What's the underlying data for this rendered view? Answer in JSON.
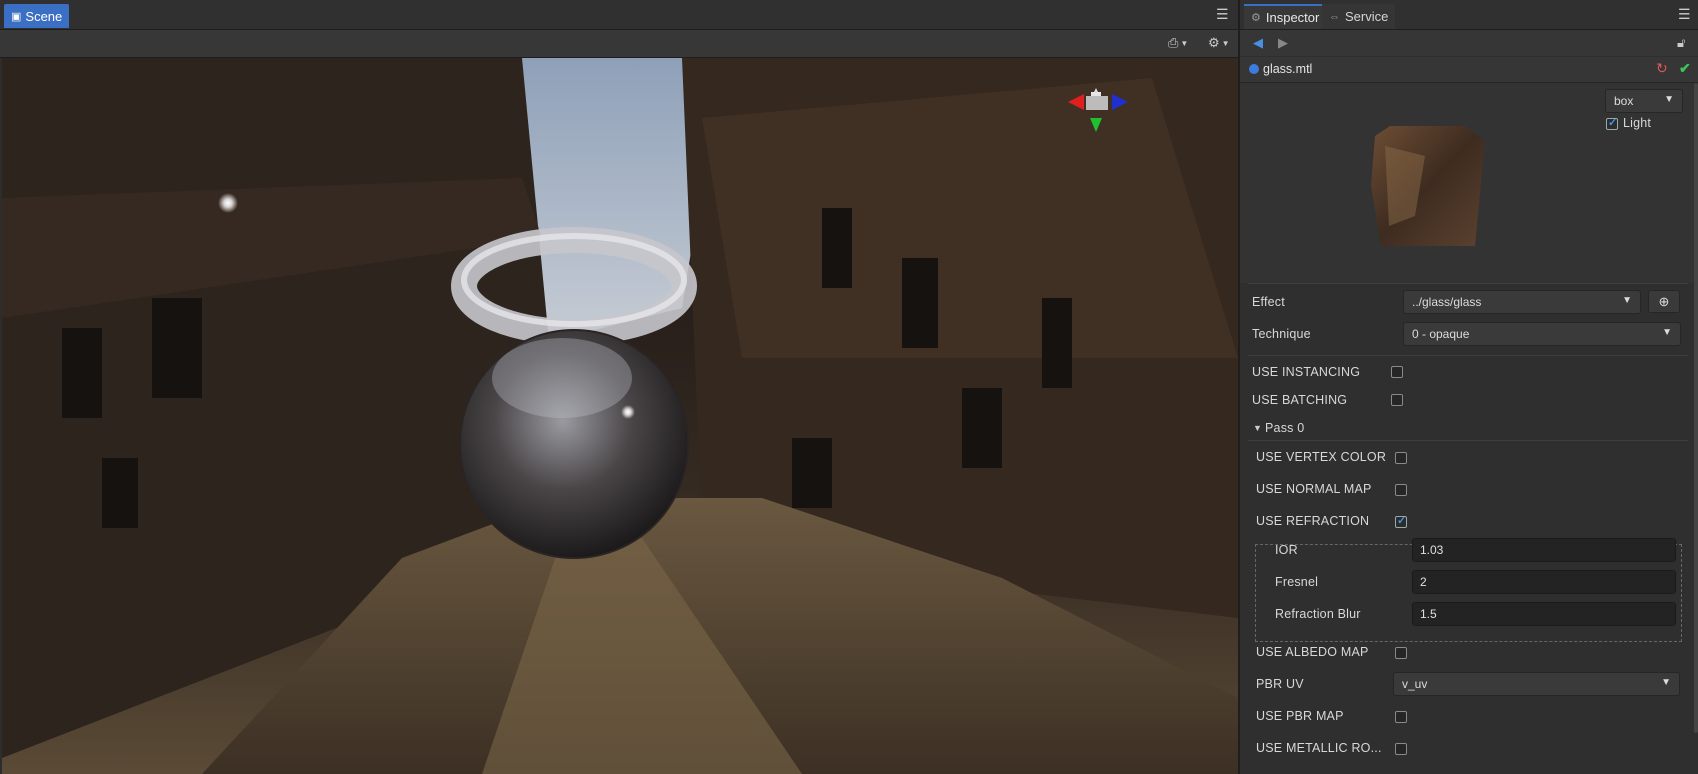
{
  "scene": {
    "tab_label": "Scene",
    "menu_icon": "hamburger-menu-icon",
    "toolbar": {
      "camera_icon": "camera-icon",
      "gear_icon": "gear-icon"
    }
  },
  "inspector": {
    "tabs": [
      {
        "label": "Inspector",
        "icon": "gear-icon"
      },
      {
        "label": "Service",
        "icon": "link-icon"
      }
    ],
    "file_name": "glass.mtl",
    "preview": {
      "mesh": "box",
      "light_label": "Light",
      "light_checked": true
    },
    "effect": {
      "label": "Effect",
      "value": "../glass/glass"
    },
    "technique": {
      "label": "Technique",
      "value": "0 - opaque"
    },
    "use_instancing": {
      "label": "USE  INSTANCING",
      "checked": false
    },
    "use_batching": {
      "label": "USE  BATCHING",
      "checked": false
    },
    "pass_label": "Pass 0",
    "pass_props": [
      {
        "label": "USE  VERTEX  COLOR",
        "checked": false
      },
      {
        "label": "USE  NORMAL  MAP",
        "checked": false
      },
      {
        "label": "USE  REFRACTION",
        "checked": true
      }
    ],
    "refraction": [
      {
        "label": "IOR",
        "value": "1.03"
      },
      {
        "label": "Fresnel",
        "value": "2"
      },
      {
        "label": "Refraction  Blur",
        "value": "1.5"
      }
    ],
    "use_albedo_map": {
      "label": "USE  ALBEDO  MAP",
      "checked": false
    },
    "pbr_uv": {
      "label": "PBR  UV",
      "value": "v_uv"
    },
    "use_pbr_map": {
      "label": "USE  PBR  MAP",
      "checked": false
    },
    "use_metallic": {
      "label": "USE  METALLIC  RO...",
      "checked": false
    }
  },
  "colors": {
    "accent": "#3b6fc4",
    "check": "#4a90e2",
    "revert": "#e05555",
    "apply": "#3cc35a"
  }
}
